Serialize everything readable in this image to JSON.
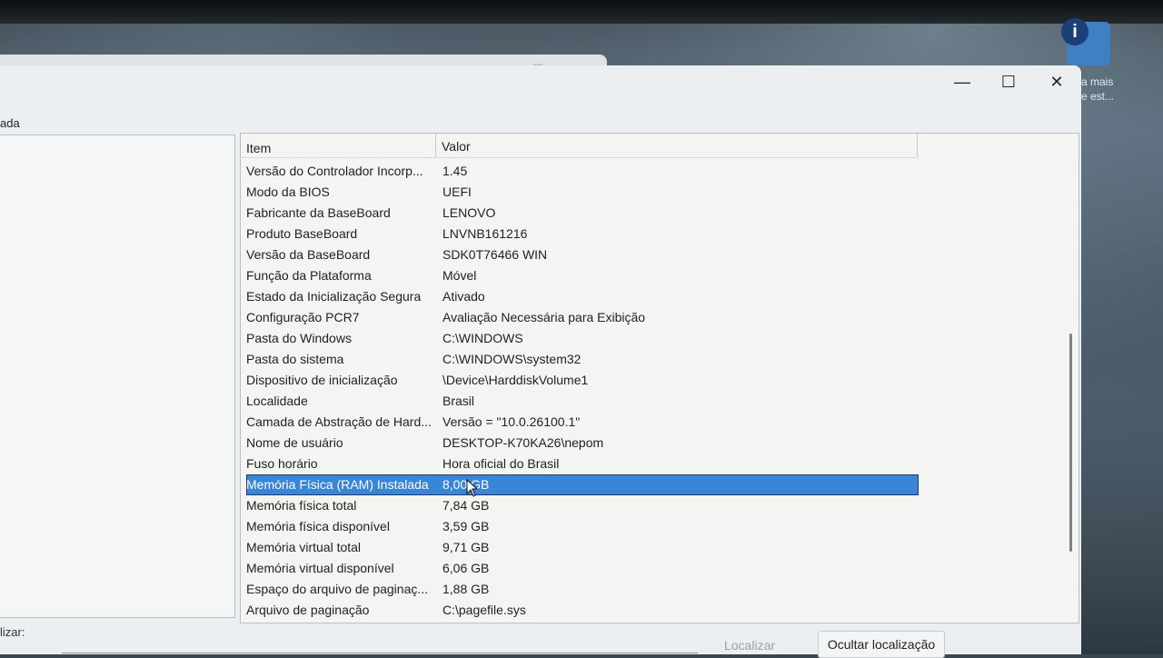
{
  "desktop": {
    "caption_line1": "a mais",
    "caption_line2": "e est..."
  },
  "window": {
    "menu_fragment": "ada",
    "minimize_icon": "minimize-icon",
    "maximize_icon": "maximize-icon",
    "close_icon": "close-icon"
  },
  "list": {
    "header_item": "Item",
    "header_value": "Valor",
    "rows": [
      {
        "item": "Versão do Controlador Incorp...",
        "value": "1.45"
      },
      {
        "item": "Modo da BIOS",
        "value": "UEFI"
      },
      {
        "item": "Fabricante da BaseBoard",
        "value": "LENOVO"
      },
      {
        "item": "Produto BaseBoard",
        "value": "LNVNB161216"
      },
      {
        "item": "Versão da BaseBoard",
        "value": "SDK0T76466 WIN"
      },
      {
        "item": "Função da Plataforma",
        "value": "Móvel"
      },
      {
        "item": "Estado da Inicialização Segura",
        "value": "Ativado"
      },
      {
        "item": "Configuração PCR7",
        "value": "Avaliação Necessária para Exibição"
      },
      {
        "item": "Pasta do Windows",
        "value": "C:\\WINDOWS"
      },
      {
        "item": "Pasta do sistema",
        "value": "C:\\WINDOWS\\system32"
      },
      {
        "item": "Dispositivo de inicialização",
        "value": "\\Device\\HarddiskVolume1"
      },
      {
        "item": "Localidade",
        "value": "Brasil"
      },
      {
        "item": "Camada de Abstração de Hard...",
        "value": "Versão = \"10.0.26100.1\""
      },
      {
        "item": "Nome de usuário",
        "value": "DESKTOP-K70KA26\\nepom"
      },
      {
        "item": "Fuso horário",
        "value": "Hora oficial do Brasil"
      },
      {
        "item": "Memória Física (RAM) Instalada",
        "value": "8,00 GB"
      },
      {
        "item": "Memória física total",
        "value": "7,84 GB"
      },
      {
        "item": "Memória física disponível",
        "value": "3,59 GB"
      },
      {
        "item": "Memória virtual total",
        "value": "9,71 GB"
      },
      {
        "item": "Memória virtual disponível",
        "value": "6,06 GB"
      },
      {
        "item": "Espaço do arquivo de paginaç...",
        "value": "1,88 GB"
      },
      {
        "item": "Arquivo de paginação",
        "value": "C:\\pagefile.sys"
      }
    ]
  },
  "find": {
    "label_fragment": "lizar:",
    "find_button": "Localizar",
    "hide_button": "Ocultar localização"
  }
}
